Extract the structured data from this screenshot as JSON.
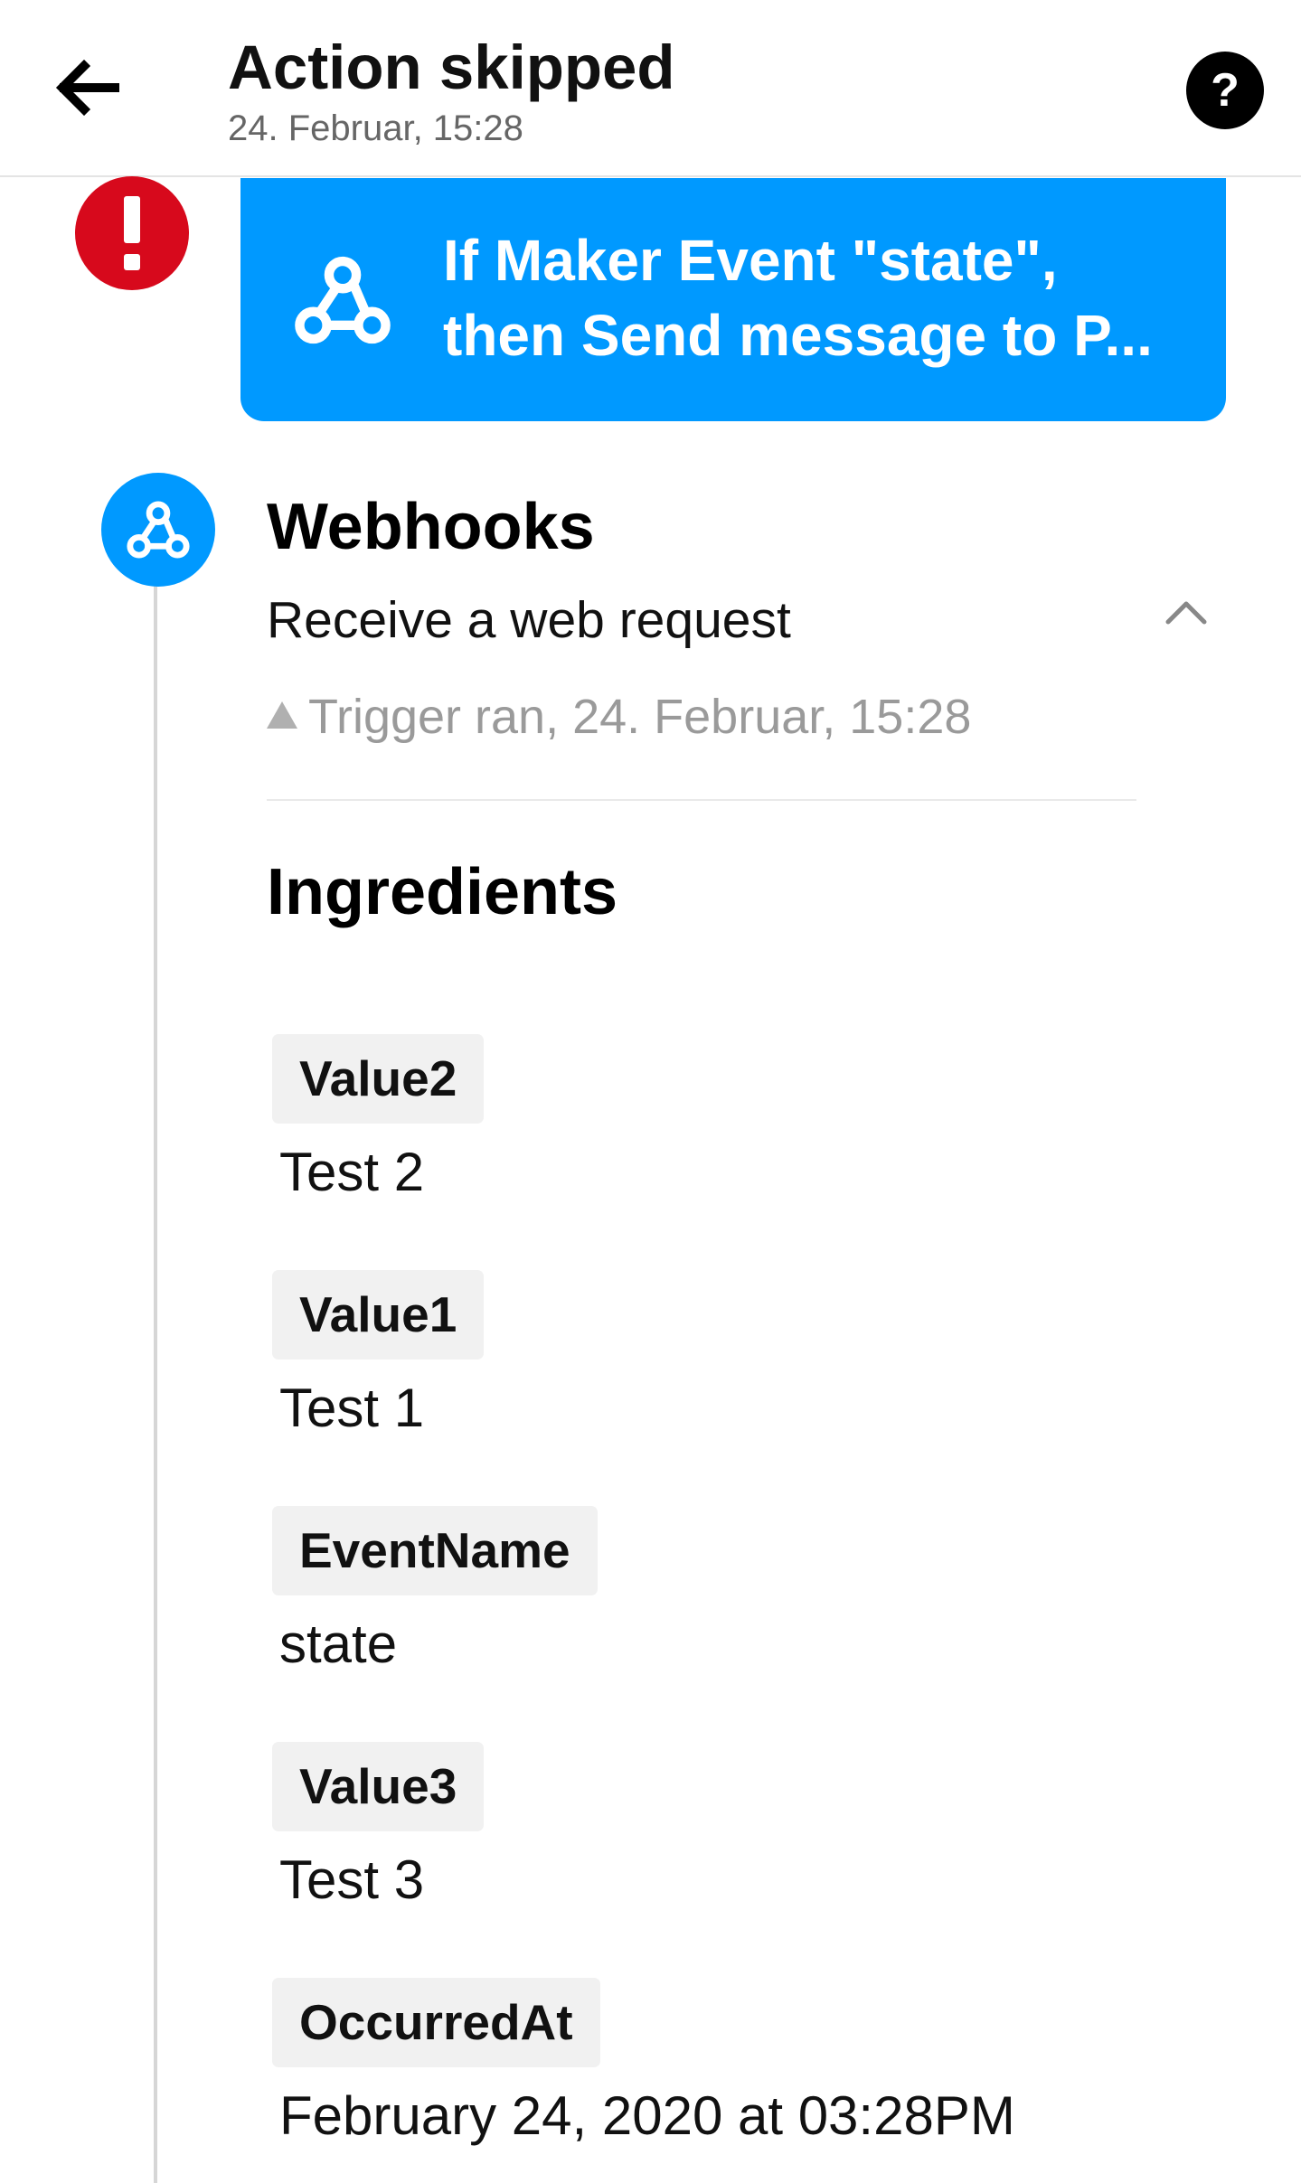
{
  "header": {
    "title": "Action skipped",
    "subtitle": "24. Februar, 15:28",
    "help_label": "?",
    "back_icon": "arrow-left-icon",
    "help_icon": "question-circle-icon"
  },
  "applet": {
    "line1": "If Maker Event \"state\",",
    "line2": "then Send message to P...",
    "icon": "webhooks-icon",
    "color": "#0099ff"
  },
  "status": {
    "icon": "exclamation-icon",
    "color": "#d7091c"
  },
  "trigger": {
    "service": "Webhooks",
    "name": "Receive a web request",
    "ran_text": "Trigger ran, 24. Februar, 15:28",
    "icon": "webhooks-icon",
    "collapse_icon": "chevron-up-icon"
  },
  "ingredients": {
    "heading": "Ingredients",
    "items": [
      {
        "name": "Value2",
        "value": "Test 2"
      },
      {
        "name": "Value1",
        "value": "Test 1"
      },
      {
        "name": "EventName",
        "value": "state"
      },
      {
        "name": "Value3",
        "value": "Test 3"
      },
      {
        "name": "OccurredAt",
        "value": "February 24, 2020 at 03:28PM"
      }
    ]
  }
}
